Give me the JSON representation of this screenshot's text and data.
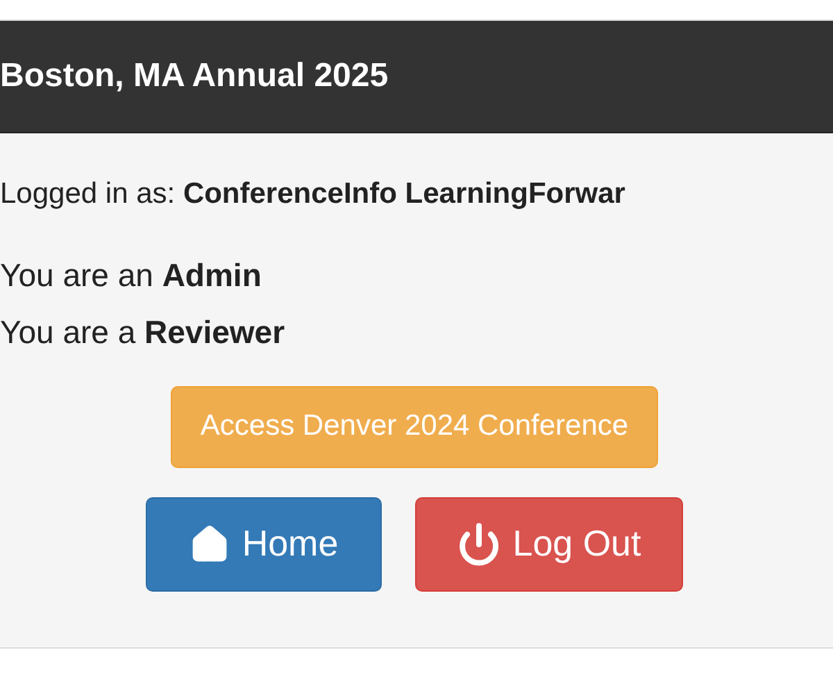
{
  "header": {
    "title": "Boston, MA Annual 2025"
  },
  "lines": [
    "Logged in as: **ConferenceInfo LearningForwar**",
    "You are an **Admin**",
    "You are a **Reviewer**"
  ],
  "buttons": [
    {
      "kind": "warning",
      "label": "Access Denver 2024 Conference"
    },
    {
      "kind": "home",
      "label": "Home"
    },
    {
      "kind": "logout",
      "label": "Log Out"
    }
  ]
}
